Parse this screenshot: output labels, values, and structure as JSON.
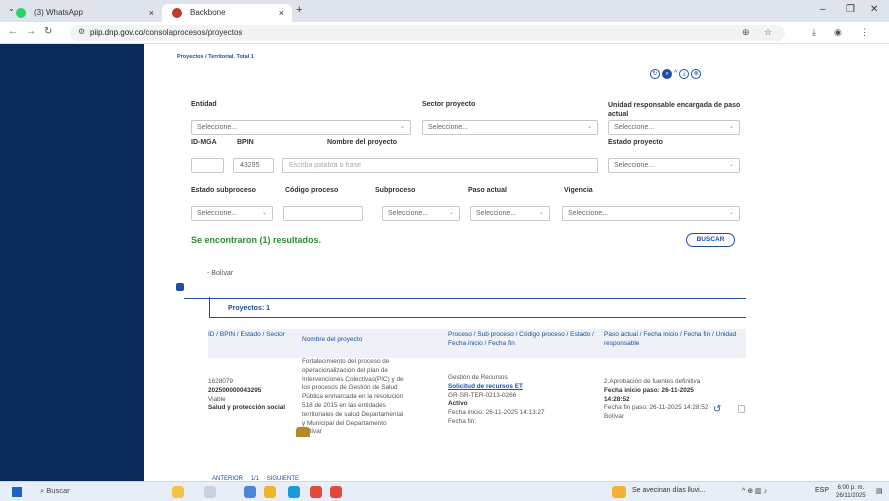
{
  "browser": {
    "tabs": [
      {
        "title": "(3) WhatsApp",
        "icon": "whatsapp-icon",
        "color": "#25d366"
      },
      {
        "title": "Backbone",
        "icon": "dnp-logo-icon",
        "color": "#c0392b"
      }
    ],
    "close_glyph": "×",
    "new_tab_glyph": "+",
    "url_host": "piip.dnp.gov.co",
    "url_path": "/consolaprocesos/proyectos"
  },
  "page": {
    "breadcrumb": "Proyectos / Territorial. Total 1",
    "filters": {
      "entidad_label": "Entidad",
      "entidad_value": "Seleccione...",
      "sector_label": "Sector proyecto",
      "sector_value": "Seleccione...",
      "unidad_label": "Unidad responsable encargada de paso actual",
      "unidad_value": "Seleccione...",
      "idmga_label": "ID-MGA",
      "idmga_value": "",
      "bpin_label": "BPIN",
      "bpin_value": "43295",
      "nombre_label": "Nombre del proyecto",
      "nombre_placeholder": "Escriba palabra o frase",
      "estado_proyecto_label": "Estado proyecto",
      "estado_proyecto_value": "Seleccione...",
      "estado_subproceso_label": "Estado subproceso",
      "estado_subproceso_value": "Seleccione...",
      "codigo_proceso_label": "Código proceso",
      "codigo_proceso_value": "",
      "subproceso_label": "Subproceso",
      "subproceso_value": "Seleccione...",
      "paso_actual_label": "Paso actual",
      "paso_actual_value": "Seleccione...",
      "vigencia_label": "Vigencia",
      "vigencia_value": "Seleccione..."
    },
    "found_text": "Se encontraron (1) resultados.",
    "search_button": "BUSCAR",
    "tree_node": "- Bolívar",
    "projects_label": "Proyectos: 1",
    "table": {
      "headers": [
        "ID / BPIN / Estado / Sector",
        "Nombre del proyecto",
        "Proceso / Sub proceso / Código proceso / Estado / Fecha inicio / Fecha fin",
        "Paso actual / Fecha inicio / Fecha fin / Unidad responsable"
      ],
      "row": {
        "id": "1628079",
        "bpin": "202500000043295",
        "estado": "Viable",
        "sector": "Salud y protección social",
        "nombre_lines": [
          "Fortalecimiento del proceso de",
          "operacionalización del plan de",
          "Intervenciones Colectivas(PIC) y de",
          "los procesos de Gestión de Salud",
          "Pública enmarcada en la resolución",
          "518 de 2015 en las entidades",
          "territoriales de salud Departamental",
          "y Municipal del Departamento",
          "Bolívar"
        ],
        "proceso": "Gestión de Recursos",
        "subproceso_link": "Solicitud de recursos ET",
        "codigo": "GR-SR-TER-0213-0266",
        "proceso_estado": "Activo",
        "fecha_inicio": "Fecha inicio: 26-11-2025 14:13:27",
        "fecha_fin": "Fecha fin:",
        "paso_actual": "2.Aprobación de fuentes definitiva",
        "paso_fecha_inicio_1": "Fecha inicio paso: 26-11-2025",
        "paso_fecha_inicio_2": "14:28:52",
        "paso_fecha_fin": "Fecha fin paso: 26-11-2025 14:28:52",
        "unidad": "Bolívar"
      }
    },
    "pager": {
      "prev": "ANTERIOR",
      "page": "1/1",
      "next": "SIGUIENTE"
    }
  },
  "taskbar": {
    "search": "Buscar",
    "weather": "Se avecinan días lluvi...",
    "lang": "ESP",
    "time": "6:00 p. m.",
    "date": "26/11/2025"
  }
}
